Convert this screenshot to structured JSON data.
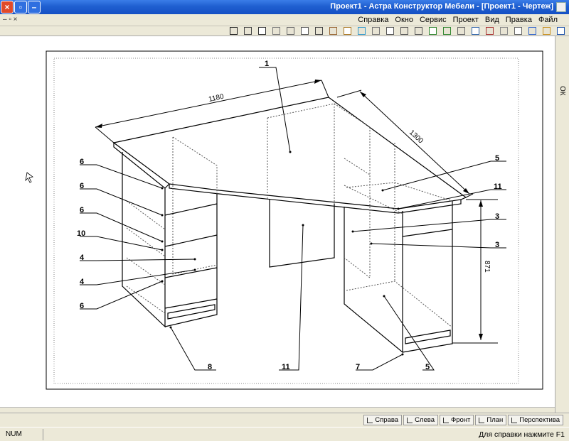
{
  "window": {
    "title": "Проект1 - Астра Конструктор Мебели - [Проект1 - Чертеж]"
  },
  "menu": {
    "items": [
      "Файл",
      "Правка",
      "Вид",
      "Проект",
      "Сервис",
      "Окно",
      "Справка"
    ],
    "mdi_controls": "– ▫ ×"
  },
  "toolbar": {
    "icons": [
      "new-icon",
      "open-icon",
      "save-icon",
      "print-icon",
      "preview-icon",
      "cut-icon",
      "copy-icon",
      "paste-icon",
      "undo-icon",
      "redo-icon",
      "zoom-in-icon",
      "zoom-out-icon",
      "zoom-window-icon",
      "pan-icon",
      "refresh-icon",
      "measure-icon",
      "layers-icon",
      "box-icon",
      "cabinet-icon",
      "shelf-icon",
      "door-icon",
      "text-icon",
      "dimension-icon",
      "select-icon"
    ]
  },
  "rightdock": {
    "ok_label": "ОК"
  },
  "drawing": {
    "dimensions": {
      "d1180": "1180",
      "d1300": "1300",
      "d871": "871"
    },
    "callouts": {
      "c1": "1",
      "c5": "5",
      "c11a": "11",
      "c3a": "3",
      "c3b": "3",
      "c6a": "6",
      "c6b": "6",
      "c6c": "6",
      "c10": "10",
      "c4a": "4",
      "c4b": "4",
      "c6d": "6",
      "c8": "8",
      "c11b": "11",
      "c7": "7",
      "c5b": "5"
    }
  },
  "tabs": [
    {
      "label": "Перспектива",
      "icon": "perspective-icon"
    },
    {
      "label": "План",
      "icon": "plan-icon"
    },
    {
      "label": "Фронт",
      "icon": "front-icon"
    },
    {
      "label": "Слева",
      "icon": "left-view-icon"
    },
    {
      "label": "Справа",
      "icon": "right-view-icon"
    }
  ],
  "statusbar": {
    "help": "Для справки нажмите F1",
    "num": "NUM"
  }
}
